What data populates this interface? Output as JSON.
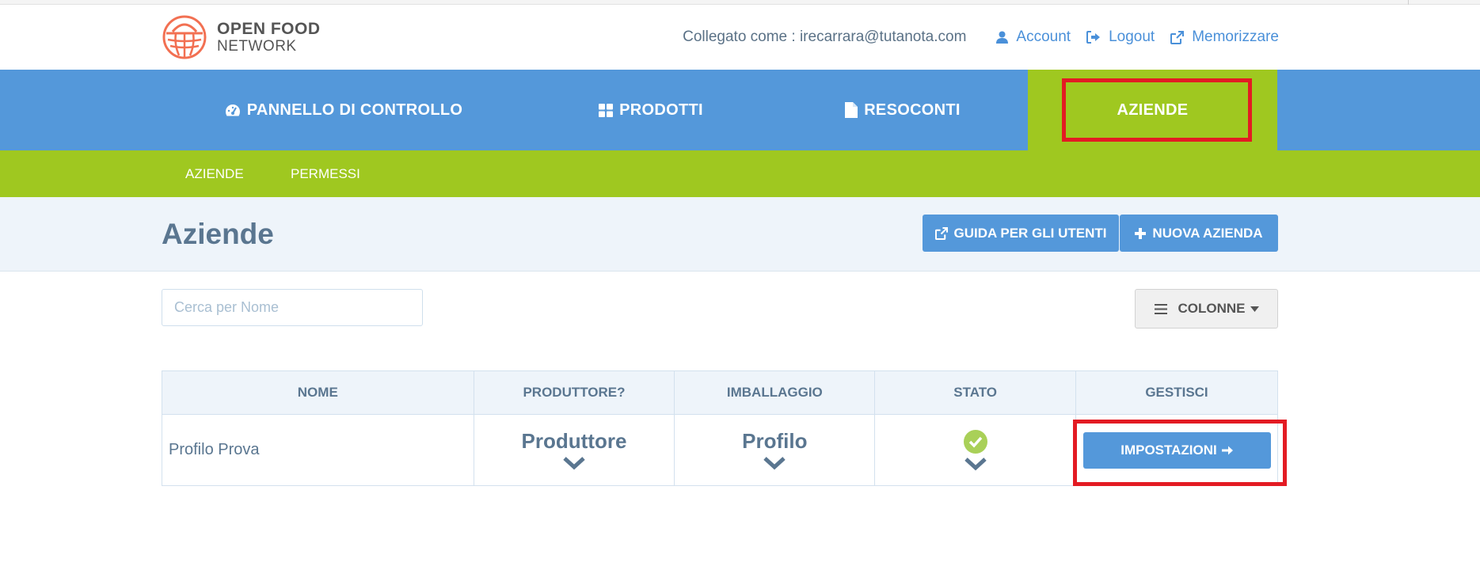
{
  "header": {
    "logo_line1": "OPEN FOOD",
    "logo_line2": "NETWORK",
    "logged_in_as": "Collegato come : irecarrara@tutanota.com",
    "account_label": "Account",
    "logout_label": "Logout",
    "store_label": "Memorizzare"
  },
  "nav": {
    "dashboard": "PANNELLO DI CONTROLLO",
    "products": "PRODOTTI",
    "reports": "RESOCONTI",
    "enterprises": "AZIENDE"
  },
  "subnav": {
    "enterprises": "AZIENDE",
    "permissions": "PERMESSI"
  },
  "page": {
    "title": "Aziende",
    "guide_button": "GUIDA PER GLI UTENTI",
    "new_button": "NUOVA AZIENDA"
  },
  "search": {
    "placeholder": "Cerca per Nome",
    "value": ""
  },
  "columns_button": "COLONNE",
  "table": {
    "headers": [
      "NOME",
      "PRODUTTORE?",
      "IMBALLAGGIO",
      "STATO",
      "GESTISCI"
    ],
    "rows": [
      {
        "name": "Profilo Prova",
        "producer": "Produttore",
        "package": "Profilo",
        "status": "ok",
        "manage_label": "IMPOSTAZIONI"
      }
    ]
  },
  "colors": {
    "primary_blue": "#5498da",
    "green": "#9fc820",
    "highlight_red": "#e31b23",
    "logo_orange": "#f27052",
    "status_ok": "#9fc820"
  },
  "icons": {
    "account": "user-icon",
    "logout": "sign-out-icon",
    "store": "external-link-icon",
    "dashboard": "tachometer-icon",
    "products": "grid-icon",
    "reports": "file-icon",
    "guide": "external-link-icon",
    "new": "plus-icon",
    "columns": "menu-icon",
    "status": "check-circle-icon",
    "dropdown": "chevron-down-icon",
    "settings_arrow": "arrow-right-icon"
  }
}
